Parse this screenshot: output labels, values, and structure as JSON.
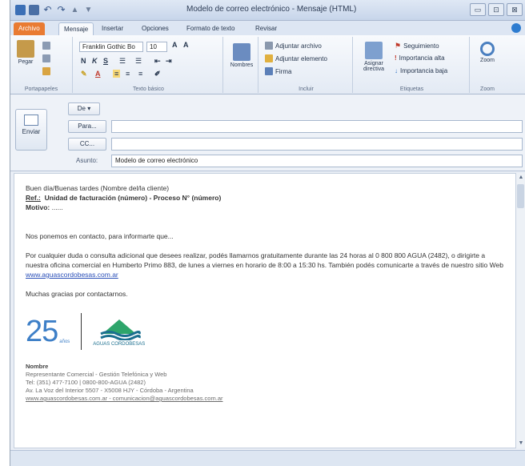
{
  "window": {
    "title": "Modelo de correo electrónico - Mensaje (HTML)",
    "controls": [
      "▭",
      "⊡",
      "⊠"
    ]
  },
  "tabs": [
    "Archivo",
    "Mensaje",
    "Insertar",
    "Opciones",
    "Formato de texto",
    "Revisar"
  ],
  "ribbon": {
    "paste_label": "Pegar",
    "clipboard_group": "Portapapeles",
    "font_name": "Franklin Gothic Bo",
    "font_size": "10",
    "basic_text_group": "Texto básico",
    "names_label": "Nombres",
    "attach_file": "Adjuntar archivo",
    "attach_item": "Adjuntar elemento",
    "signature": "Firma",
    "include_group": "Incluir",
    "assign_policy": "Asignar directiva",
    "follow_up": "Seguimiento",
    "high_importance": "Importancia alta",
    "low_importance": "Importancia baja",
    "tags_group": "Etiquetas",
    "zoom_label": "Zoom",
    "zoom_group": "Zoom"
  },
  "header": {
    "send_label": "Enviar",
    "from_label": "De",
    "to_label": "Para...",
    "cc_label": "CC...",
    "subject_label": "Asunto:",
    "subject_value": "Modelo de correo electrónico"
  },
  "body": {
    "greeting": "Buen día/Buenas tardes (Nombre del/la cliente)",
    "ref_label": "Ref.:",
    "ref_value": "Unidad de facturación (número) - Proceso N° (número)",
    "motivo_label": "Motivo:",
    "motivo_value": "......",
    "intro": "Nos ponemos en contacto, para informarte que...",
    "contact_text": "Por cualquier duda o consulta adicional que desees realizar, podés llamarnos gratuitamente durante las 24 horas al 0 800 800 AGUA (2482), o dirigirte a nuestra oficina comercial en Humberto Primo 883, de lunes a viernes en horario de 8:00 a 15:30 hs.",
    "web_text": "También podés comunicarte a través de nuestro sitio Web",
    "web_link": "www.aguascordobesas.com.ar",
    "thanks": "Muchas gracias por contactarnos.",
    "logo_number": "25",
    "logo_number_sub": "años",
    "logo_brand": "AGUAS CORDOBESAS"
  },
  "signature": {
    "name": "Nombre",
    "role": "Representante Comercial - Gestión Telefónica y Web",
    "phone": "Tel: (351) 477-7100 | 0800-800-AGUA (2482)",
    "address": "Av. La Voz del Interior 5507 - X5008 HJY - Córdoba - Argentina",
    "links": "www.aguascordobesas.com.ar - comunicacion@aguascordobesas.com.ar"
  },
  "colors": {
    "file_tab": "#e97b32",
    "accent_blue": "#3d7fc7",
    "brand_teal": "#1b6f8f",
    "link": "#2a4fb8"
  }
}
